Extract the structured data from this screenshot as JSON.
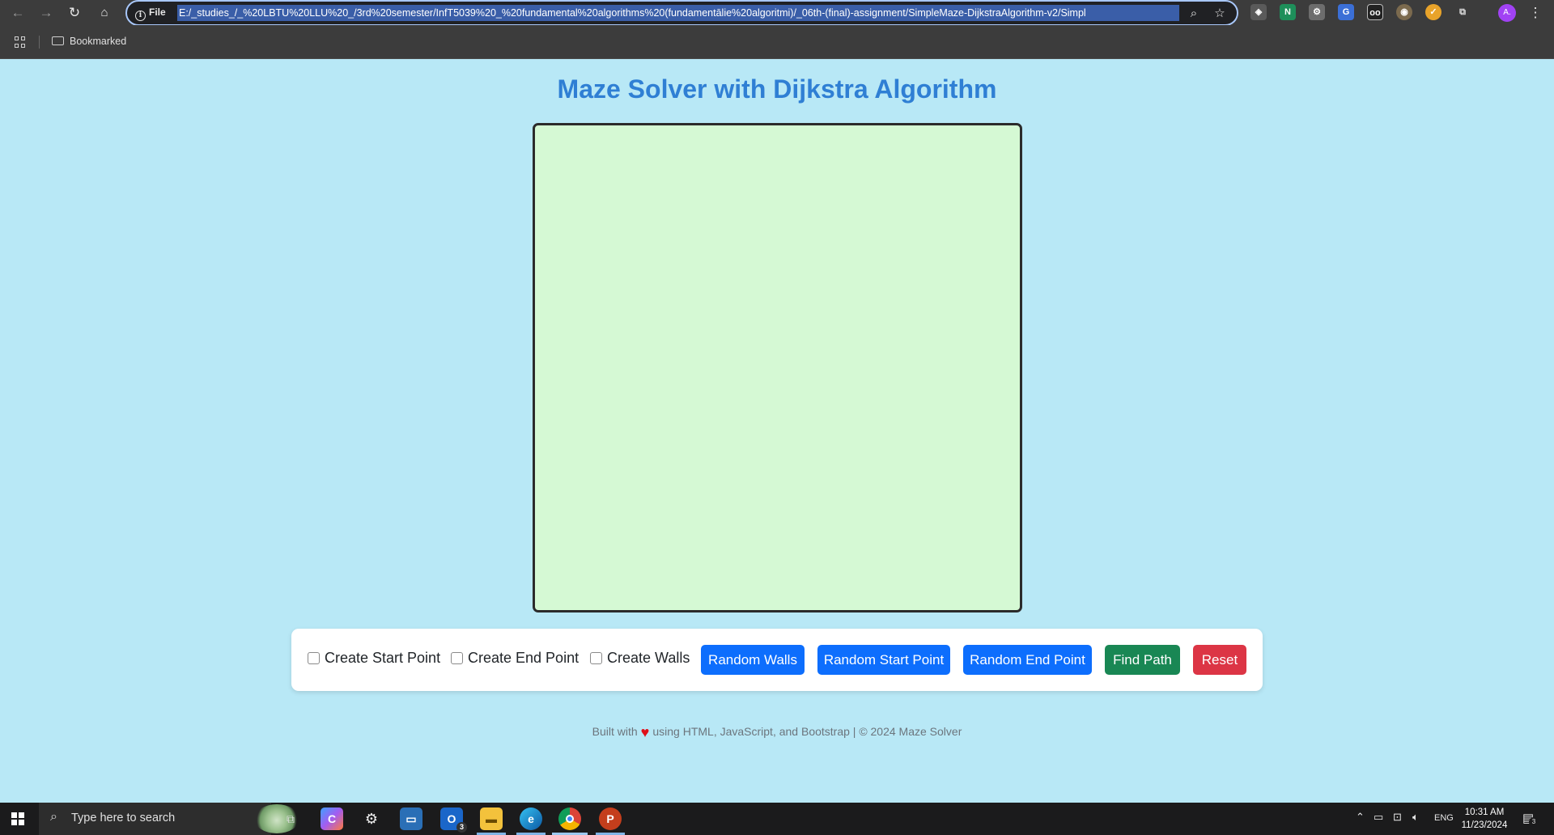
{
  "browser": {
    "url_scheme": "File",
    "url": "E:/_studies_/_%20LBTU%20LLU%20_/3rd%20semester/InfT5039%20_%20fundamental%20algorithms%20(fundamentālie%20algoritmi)/_06th-(final)-assignment/SimpleMaze-DijkstraAlgorithm-v2/Simpl",
    "profile_initial": "A.",
    "bookmark_folder": "Bookmarked",
    "extensions": [
      "ublock-icon",
      "notion-icon",
      "gear-ext-icon",
      "translate-icon",
      "glasses-icon",
      "globe-icon",
      "speed-icon",
      "puzzle-icon"
    ]
  },
  "app": {
    "title": "Maze Solver with Dijkstra Algorithm",
    "controls": {
      "create_start": "Create Start Point",
      "create_end": "Create End Point",
      "create_walls": "Create Walls",
      "random_walls": "Random Walls",
      "random_start": "Random Start Point",
      "random_end": "Random End Point",
      "find_path": "Find Path",
      "reset": "Reset"
    },
    "footer": {
      "prefix": "Built with",
      "suffix": "using HTML, JavaScript, and Bootstrap | © 2024 Maze Solver"
    },
    "colors": {
      "background": "#b8e8f6",
      "title": "#2f7fd4",
      "maze_bg": "#d5f9d4",
      "primary": "#0d6efd",
      "success": "#198754",
      "danger": "#dc3545"
    }
  },
  "taskbar": {
    "search_placeholder": "Type here to search",
    "badge_outlook": "3",
    "notification_count": "3",
    "language": "ENG",
    "time": "10:31 AM",
    "date": "11/23/2024"
  }
}
